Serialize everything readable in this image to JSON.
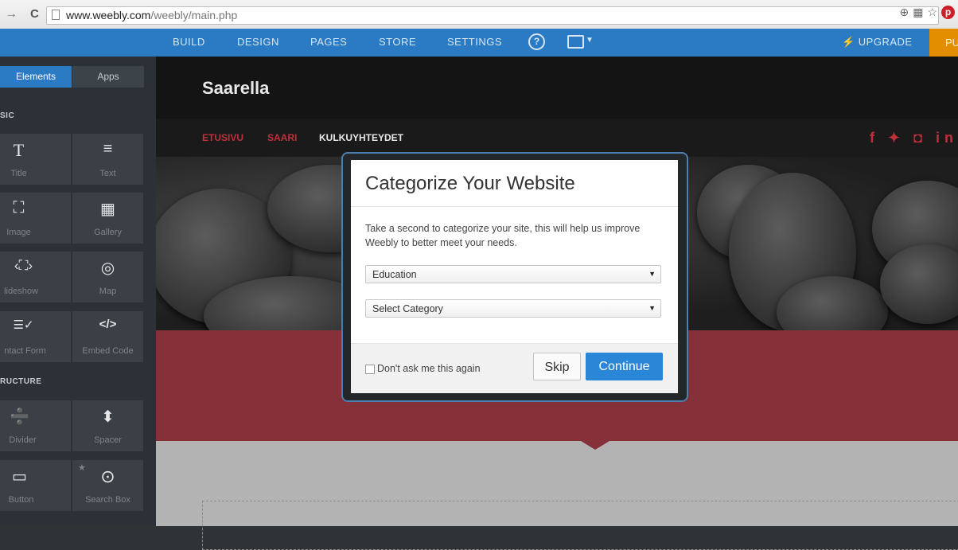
{
  "browser": {
    "url_domain": "www.weebly.com",
    "url_path": "/weebly/main.php",
    "back": "←",
    "forward": "→",
    "reload": "C",
    "icons": [
      "zoom-icon",
      "translate-icon",
      "star-icon",
      "pinterest-icon"
    ]
  },
  "topnav": {
    "items": [
      "BUILD",
      "DESIGN",
      "PAGES",
      "STORE",
      "SETTINGS"
    ],
    "help": "?",
    "upgrade": "⚡ UPGRADE",
    "publish": "PU"
  },
  "sidebar": {
    "tabs": [
      "Elements",
      "Apps"
    ],
    "section_basic": "SIC",
    "section_structure": "RUCTURE",
    "tiles": [
      {
        "label": "Title",
        "icon": "T"
      },
      {
        "label": "Text",
        "icon": "≡"
      },
      {
        "label": "Image",
        "icon": "⛶"
      },
      {
        "label": "Gallery",
        "icon": "▦"
      },
      {
        "label": "lideshow",
        "icon": "‹⛶›"
      },
      {
        "label": "Map",
        "icon": "◎"
      },
      {
        "label": "ntact Form",
        "icon": "☰✓"
      },
      {
        "label": "Embed Code",
        "icon": "</>"
      },
      {
        "label": "Divider",
        "icon": "➗"
      },
      {
        "label": "Spacer",
        "icon": "⬍"
      },
      {
        "label": "Button",
        "icon": "▭"
      },
      {
        "label": "Search Box",
        "icon": "⊙"
      }
    ]
  },
  "site": {
    "title": "Saarella",
    "menu": [
      "ETUSIVU",
      "SAARI",
      "KULKUYHTEYDET"
    ],
    "social": "f ✦ ◘ in",
    "accent": "#86303a"
  },
  "modal": {
    "title": "Categorize Your Website",
    "body": "Take a second to categorize your site, this will help us improve Weebly to better meet your needs.",
    "select1": "Education",
    "select2": "Select Category",
    "checkbox_label": "Don't ask me this again",
    "skip": "Skip",
    "continue": "Continue"
  }
}
